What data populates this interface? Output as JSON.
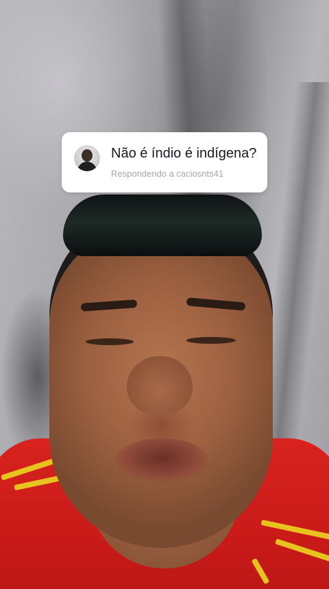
{
  "reply_card": {
    "question": "Não é índio é indígena?",
    "replying_to": "Respondendo a caciosnts41",
    "avatar_icon": "user-avatar"
  },
  "colors": {
    "card_background": "#ffffff",
    "question_text": "#161823",
    "subtitle_text": "#a6a6ab",
    "shirt": "#d8231f",
    "shirt_stripe": "#e8c21f"
  }
}
